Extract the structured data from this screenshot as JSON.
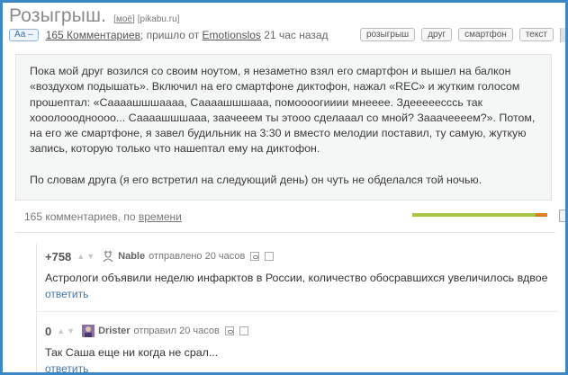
{
  "header": {
    "title": "Розыгрыш.",
    "my_link": "моё",
    "site": "[pikabu.ru]",
    "font_button": "Аа –",
    "comments_link": "165 Комментариев",
    "came_from_text": "; пришло от",
    "author_link": "Emotionslos",
    "time_ago": "21 час назад",
    "tags": [
      "розыгрыш",
      "друг",
      "смартфон",
      "текст"
    ]
  },
  "story": {
    "paragraphs": [
      "Пока мой друг возился со своим ноутом, я незаметно взял его смартфон и вышел на балкон «воздухом подышать». Включил на его смартфоне диктофон, нажал «REC» и жутким голосом прошептал: «Саааашшшаааа, Саааашшшааа, помоооогииии мнееее. Здееееесссь так хооолоооднoooo... Саааашшшааа, заачееем ты этооо сделааал со мной? Зааачеееем?». Потом, на его же смартфоне, я завел будильник на 3:30 и вместо мелодии поставил, ту самую, жуткую запись, которую только что нашептал ему на диктофон.",
      "По словам друга (я его встретил на следующий день) он чуть не обделался той ночью."
    ]
  },
  "comments_header": {
    "count_text": "165 комментариев, по",
    "sort_link": "времени"
  },
  "rating": {
    "positive_fraction": 0.91,
    "positive_color": "#a7c53f",
    "negative_color": "#e37d22"
  },
  "comments": [
    {
      "score": "+758",
      "author": "Nable",
      "posted": "отправлено 20 часов",
      "text": "Астрологи объявили неделю инфарктов в России, количество обосравшихся увеличилось вдвое",
      "reply": "ответить"
    },
    {
      "score": "0",
      "author": "Drister",
      "posted": "отправил 20 часов",
      "text": "Так Саша еще ни когда не срал...",
      "reply": "ответить"
    }
  ],
  "accent_color": "#3c88c6"
}
